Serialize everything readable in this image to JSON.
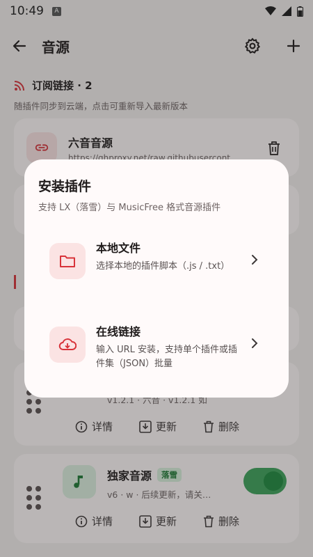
{
  "status_bar": {
    "time": "10:49",
    "badge": "A"
  },
  "app_bar": {
    "title": "音源"
  },
  "section": {
    "title": "订阅链接 · 2",
    "subtitle": "随插件同步到云端，点击可重新导入最新版本"
  },
  "subscriptions": [
    {
      "name": "六音音源",
      "url": "https://ghproxy.net/raw.githubusercont"
    }
  ],
  "plugins": [
    {
      "name": "",
      "tag": "",
      "desc": "v1.2.1 · 六音 · v1.2.1 如",
      "enabled": true
    },
    {
      "name": "独家音源",
      "tag": "落雪",
      "desc": "v6 · w · 后续更新，请关…",
      "enabled": true
    }
  ],
  "actions": {
    "details": "详情",
    "update": "更新",
    "delete": "删除"
  },
  "dialog": {
    "title": "安装插件",
    "subtitle": "支持 LX（落雪）与 MusicFree 格式音源插件",
    "options": [
      {
        "title": "本地文件",
        "desc": "选择本地的插件脚本（.js / .txt）"
      },
      {
        "title": "在线链接",
        "desc": "输入 URL 安装，支持单个插件或插件集（JSON）批量"
      }
    ]
  },
  "colors": {
    "accent": "#d8333a",
    "accent_bg": "#fbe3e3",
    "green": "#1e8a3e",
    "surface": "#fffafa"
  }
}
